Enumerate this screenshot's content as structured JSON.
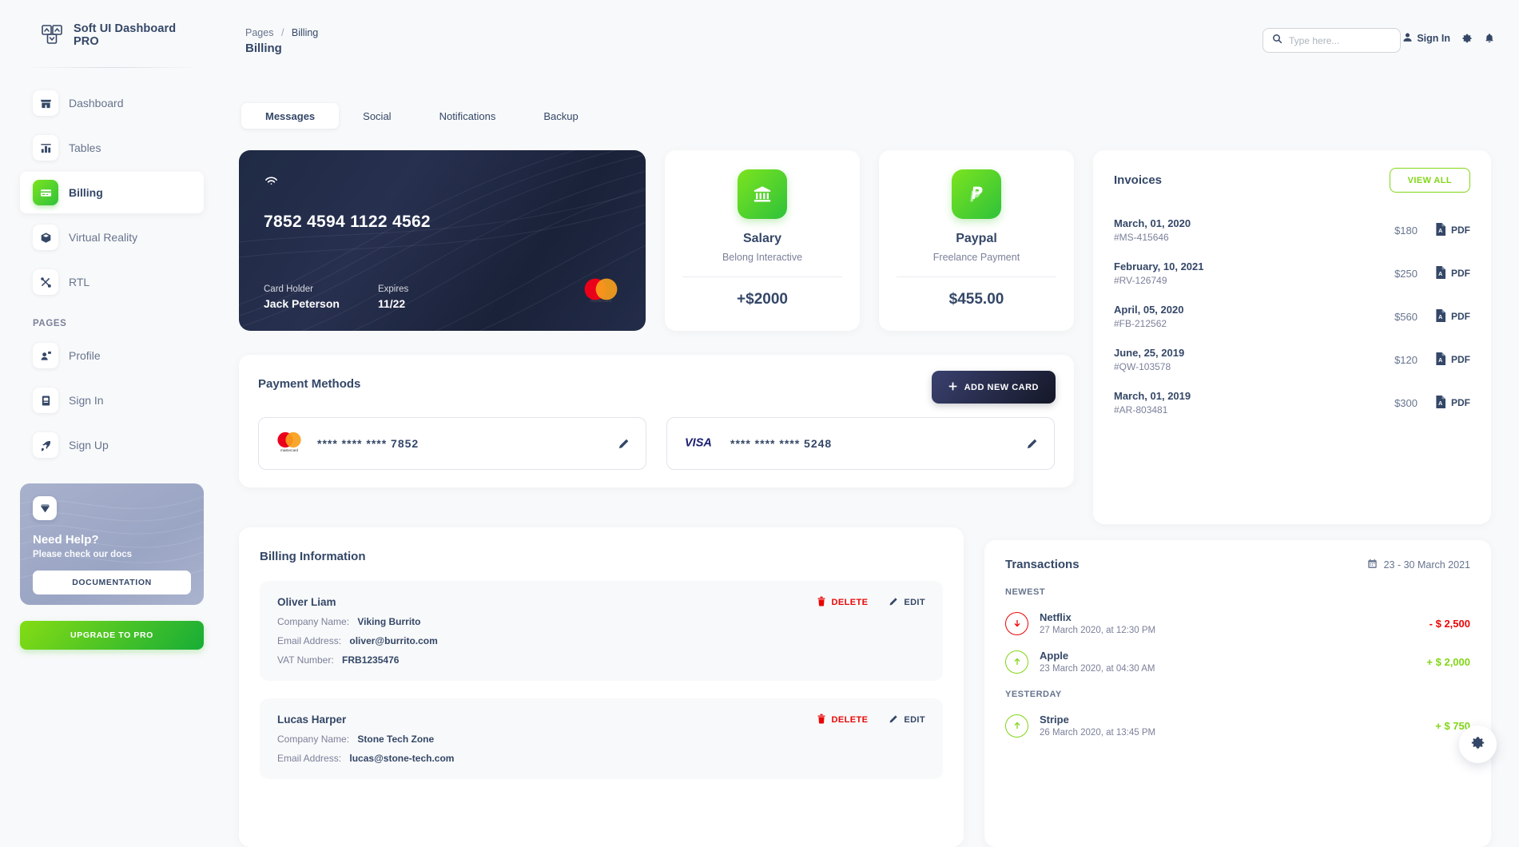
{
  "brand": {
    "name": "Soft UI Dashboard PRO"
  },
  "sidebar": {
    "items": [
      {
        "label": "Dashboard",
        "icon": "shop-icon"
      },
      {
        "label": "Tables",
        "icon": "chart-bar-icon"
      },
      {
        "label": "Billing",
        "icon": "credit-card-icon"
      },
      {
        "label": "Virtual Reality",
        "icon": "box-icon"
      },
      {
        "label": "RTL",
        "icon": "tools-icon"
      }
    ],
    "section_pages": "PAGES",
    "pages": [
      {
        "label": "Profile",
        "icon": "user-profile-icon"
      },
      {
        "label": "Sign In",
        "icon": "document-icon"
      },
      {
        "label": "Sign Up",
        "icon": "rocket-icon"
      }
    ],
    "help": {
      "title": "Need Help?",
      "subtitle": "Please check our docs",
      "button": "DOCUMENTATION"
    },
    "upgrade_button": "UPGRADE TO PRO"
  },
  "topbar": {
    "breadcrumb_root": "Pages",
    "breadcrumb_sep": "/",
    "breadcrumb_current": "Billing",
    "page_title": "Billing",
    "search_placeholder": "Type here...",
    "search_value": "",
    "sign_in": "Sign In"
  },
  "tabs": [
    {
      "label": "Messages",
      "active": true
    },
    {
      "label": "Social",
      "active": false
    },
    {
      "label": "Notifications",
      "active": false
    },
    {
      "label": "Backup",
      "active": false
    }
  ],
  "credit_card": {
    "number": "7852 4594 1122 4562",
    "holder_label": "Card Holder",
    "holder_value": "Jack Peterson",
    "expires_label": "Expires",
    "expires_value": "11/22",
    "brand": "mastercard-logo"
  },
  "info_cards": [
    {
      "title": "Salary",
      "subtitle": "Belong Interactive",
      "amount": "+$2000",
      "icon": "bank-icon"
    },
    {
      "title": "Paypal",
      "subtitle": "Freelance Payment",
      "amount": "$455.00",
      "icon": "paypal-icon"
    }
  ],
  "payment_methods": {
    "title": "Payment Methods",
    "add_button": "ADD NEW CARD",
    "cards": [
      {
        "brand": "mastercard-logo",
        "masked": "****  ****  ****  7852"
      },
      {
        "brand": "visa-logo",
        "masked": "****  ****  ****  5248"
      }
    ]
  },
  "invoices": {
    "title": "Invoices",
    "view_all": "VIEW ALL",
    "pdf_label": "PDF",
    "rows": [
      {
        "date": "March, 01, 2020",
        "id": "#MS-415646",
        "amount": "$180"
      },
      {
        "date": "February, 10, 2021",
        "id": "#RV-126749",
        "amount": "$250"
      },
      {
        "date": "April, 05, 2020",
        "id": "#FB-212562",
        "amount": "$560"
      },
      {
        "date": "June, 25, 2019",
        "id": "#QW-103578",
        "amount": "$120"
      },
      {
        "date": "March, 01, 2019",
        "id": "#AR-803481",
        "amount": "$300"
      }
    ]
  },
  "billing_information": {
    "title": "Billing Information",
    "delete_label": "DELETE",
    "edit_label": "EDIT",
    "labels": {
      "company": "Company Name:",
      "email": "Email Address:",
      "vat": "VAT Number:"
    },
    "entries": [
      {
        "name": "Oliver Liam",
        "company": "Viking Burrito",
        "email": "oliver@burrito.com",
        "vat": "FRB1235476"
      },
      {
        "name": "Lucas Harper",
        "company": "Stone Tech Zone",
        "email": "lucas@stone-tech.com",
        "vat": ""
      }
    ]
  },
  "transactions": {
    "title": "Transactions",
    "date_range": "23 - 30 March 2021",
    "groups": [
      {
        "label": "NEWEST",
        "rows": [
          {
            "name": "Netflix",
            "time": "27 March 2020, at 12:30 PM",
            "amount": "- $ 2,500",
            "direction": "down"
          },
          {
            "name": "Apple",
            "time": "23 March 2020, at 04:30 AM",
            "amount": "+ $ 2,000",
            "direction": "up"
          }
        ]
      },
      {
        "label": "YESTERDAY",
        "rows": [
          {
            "name": "Stripe",
            "time": "26 March 2020, at 13:45 PM",
            "amount": "+ $ 750",
            "direction": "up"
          }
        ]
      }
    ]
  },
  "colors": {
    "accent_green": "#82d616",
    "danger_red": "#ea0606",
    "dark_navy": "#344767",
    "muted": "#7b809a",
    "page_bg": "#f8f9fa"
  }
}
